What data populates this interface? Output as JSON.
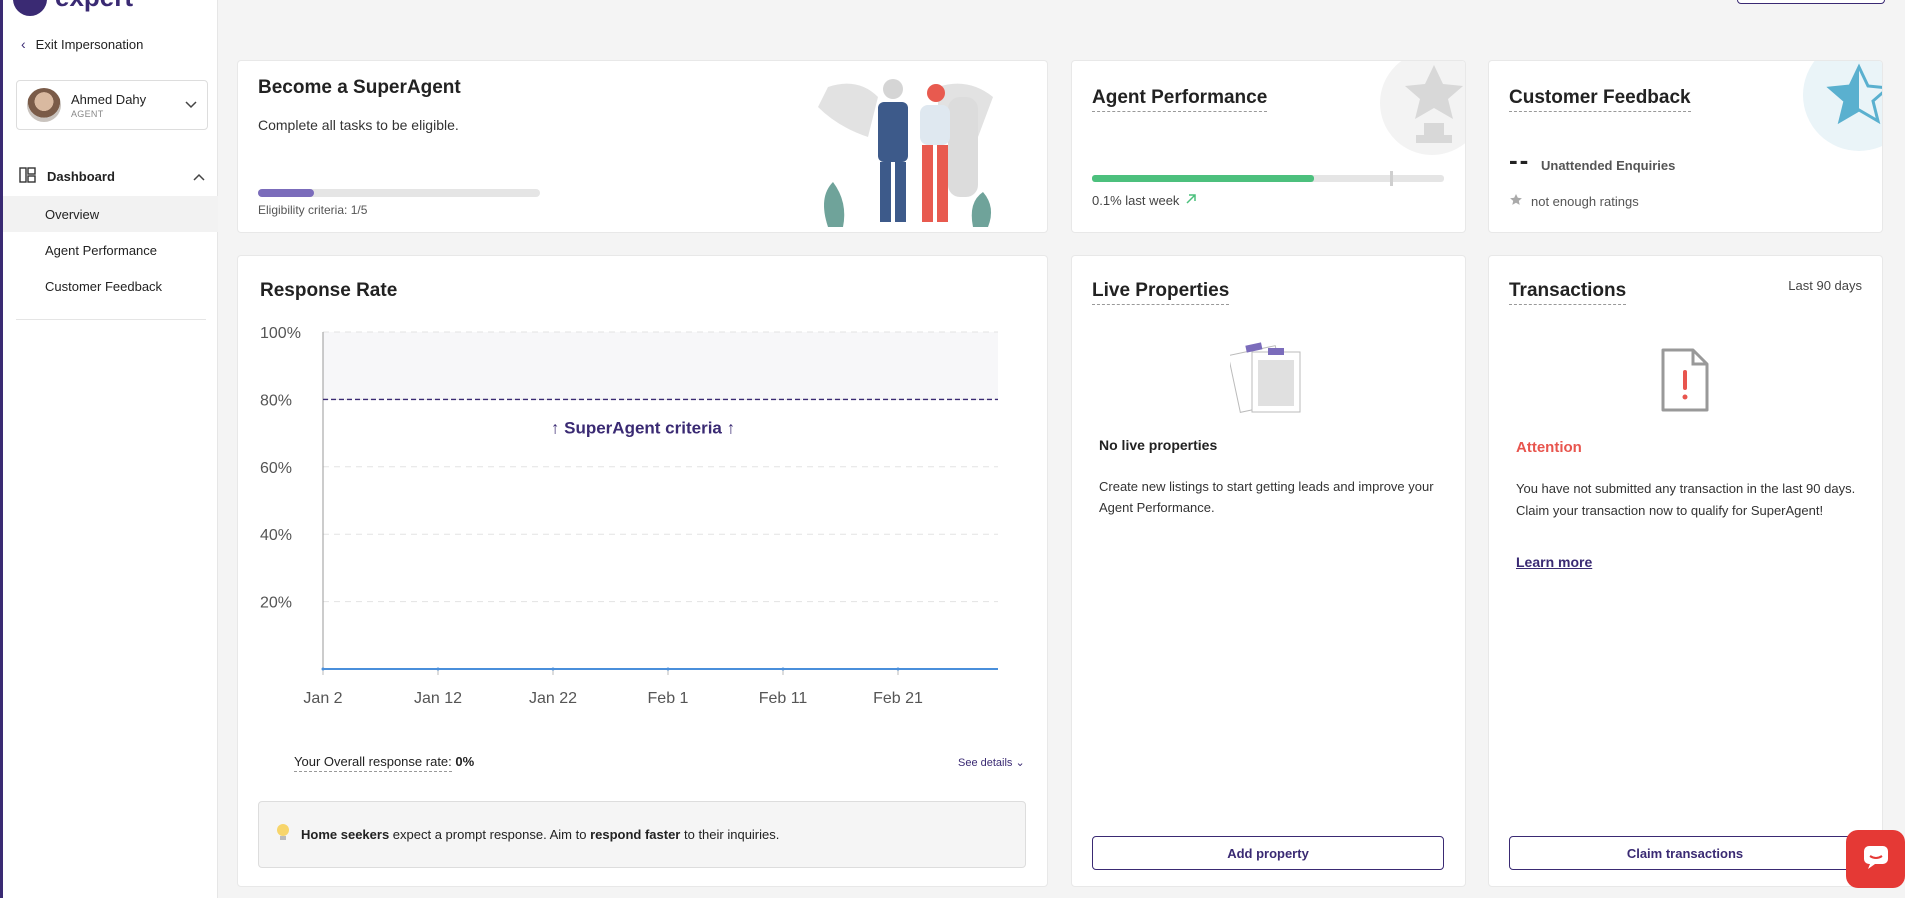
{
  "brand": {
    "logo_text": "expert"
  },
  "sidebar": {
    "exit_label": "Exit Impersonation",
    "user": {
      "name": "Ahmed Dahy",
      "role": "AGENT"
    },
    "section_label": "Dashboard",
    "items": [
      {
        "label": "Overview"
      },
      {
        "label": "Agent Performance"
      },
      {
        "label": "Customer Feedback"
      }
    ]
  },
  "superagent": {
    "title": "Become a SuperAgent",
    "subtitle": "Complete all tasks to be eligible.",
    "criteria_label": "Eligibility criteria: 1/5",
    "progress_fraction": 0.2
  },
  "agent_performance": {
    "title": "Agent Performance",
    "trend_label": "0.1% last week",
    "progress_fraction": 0.63
  },
  "customer_feedback": {
    "title": "Customer Feedback",
    "value": "--",
    "value_label": "Unattended Enquiries",
    "rating_label": "not enough ratings"
  },
  "response_rate": {
    "title": "Response Rate",
    "overall_label": "Your Overall response rate:",
    "overall_value": "0%",
    "see_details": "See details",
    "tip": {
      "part1": "Home seekers",
      "part2": " expect a prompt response. Aim to ",
      "part3": "respond faster",
      "part4": " to their inquiries."
    }
  },
  "live_properties": {
    "title": "Live Properties",
    "empty_title": "No live properties",
    "empty_desc": "Create new listings to start getting leads and improve your Agent Performance.",
    "button": "Add property"
  },
  "transactions": {
    "title": "Transactions",
    "period": "Last 90 days",
    "attention": "Attention",
    "message": "You have not submitted any transaction in the last 90 days. Claim your transaction now to qualify for SuperAgent!",
    "learn_more": "Learn more",
    "button": "Claim transactions"
  },
  "chart_data": {
    "type": "line",
    "title": "Response Rate",
    "x": [
      "Jan 2",
      "Jan 12",
      "Jan 22",
      "Feb 1",
      "Feb 11",
      "Feb 21"
    ],
    "y_ticks": [
      "20%",
      "40%",
      "60%",
      "80%",
      "100%"
    ],
    "ylim": [
      0,
      100
    ],
    "series": [
      {
        "values": [
          0,
          0,
          0,
          0,
          0,
          0
        ]
      }
    ],
    "reference_line": {
      "value": 80,
      "label": "↑ SuperAgent criteria ↑"
    },
    "grid": true,
    "colors": {
      "series": "#4a8fdb",
      "reference": "#3a2a73"
    }
  },
  "colors": {
    "brand": "#3a2a73",
    "success": "#4cc07d",
    "danger": "#e8554e"
  }
}
